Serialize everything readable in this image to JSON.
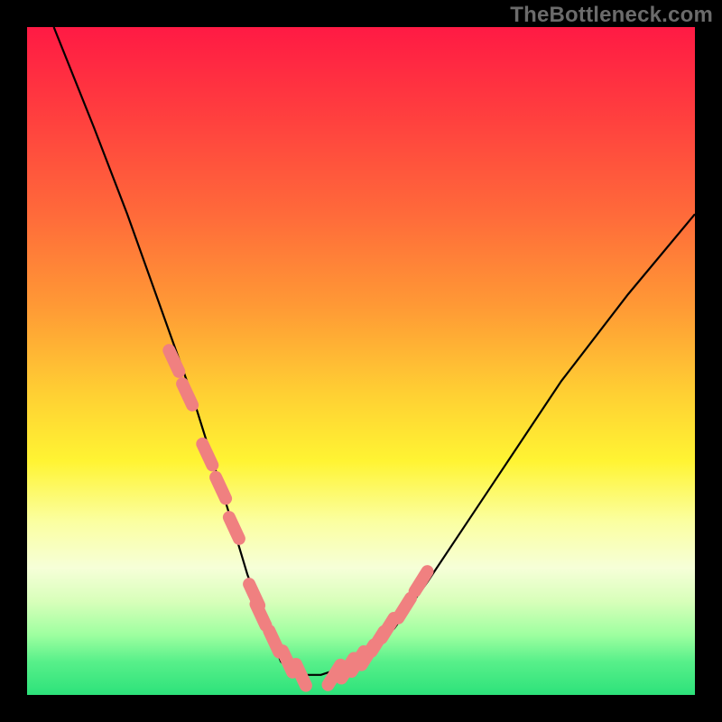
{
  "watermark": "TheBottleneck.com",
  "chart_data": {
    "type": "line",
    "title": "",
    "xlabel": "",
    "ylabel": "",
    "xlim": [
      0,
      100
    ],
    "ylim": [
      0,
      100
    ],
    "grid": false,
    "series": [
      {
        "name": "bottleneck-curve",
        "type": "line",
        "stroke": "#000000",
        "x": [
          4,
          10,
          15,
          20,
          25,
          30,
          33,
          36,
          38,
          40,
          44,
          50,
          55,
          60,
          70,
          80,
          90,
          100
        ],
        "y": [
          100,
          85,
          72,
          58,
          44,
          28,
          18,
          10,
          5,
          3,
          3,
          5,
          10,
          17,
          32,
          47,
          60,
          72
        ]
      },
      {
        "name": "left-markers",
        "type": "scatter",
        "stroke": "#f08080",
        "x": [
          22,
          24,
          27,
          29,
          31,
          34,
          35,
          37,
          39,
          41
        ],
        "y": [
          50,
          45,
          36,
          31,
          25,
          15,
          12,
          8,
          5,
          3
        ]
      },
      {
        "name": "right-markers",
        "type": "scatter",
        "stroke": "#f08080",
        "x": [
          46,
          48,
          49.5,
          51,
          52.5,
          54,
          56.5,
          59
        ],
        "y": [
          3,
          4,
          5,
          6,
          8,
          10,
          13,
          17
        ]
      }
    ],
    "background_gradient": {
      "direction": "vertical",
      "stops": [
        {
          "pos": 0.0,
          "color": "#ff1a44"
        },
        {
          "pos": 0.55,
          "color": "#ffd033"
        },
        {
          "pos": 0.74,
          "color": "#fbffa0"
        },
        {
          "pos": 1.0,
          "color": "#2de27a"
        }
      ]
    }
  }
}
